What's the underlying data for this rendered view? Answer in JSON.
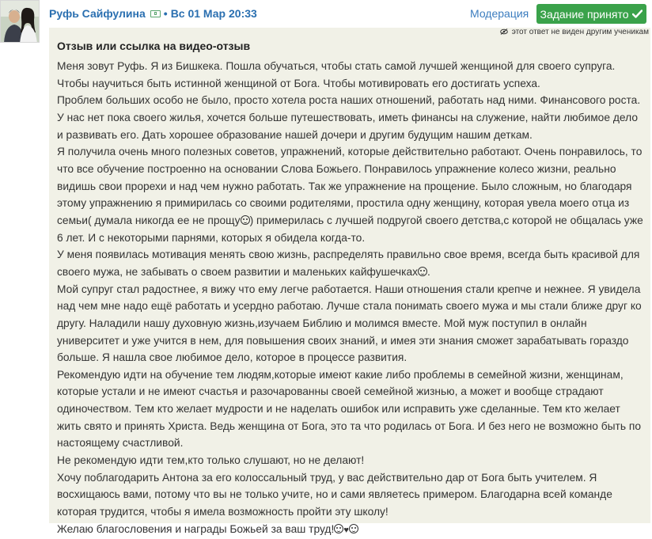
{
  "author": {
    "name": "Руфь Сайфулина",
    "separator": "•",
    "datetime": "Вс 01 Мар 20:33"
  },
  "actions": {
    "moderation_label": "Модерация",
    "status_label": "Задание принято"
  },
  "post": {
    "visibility_note": "этот ответ не виден другим ученикам",
    "title": "Отзыв или ссылка на видео-отзыв",
    "paragraphs": [
      "Меня зовут Руфь. Я из Бишкека. Пошла обучаться, чтобы стать самой лучшей женщиной для своего супруга. Чтобы научиться быть истинной женщиной от Бога. Чтобы мотивировать его достигать успеха.",
      "Проблем больших особо не было, просто хотела роста наших отношений, работать над ними. Финансового роста. У нас нет пока своего жилья, хочется больше путешествовать, иметь финансы на служение, найти любимое дело и развивать его. Дать хорошее образование нашей дочери и другим будущим нашим деткам.",
      "Я получила очень много полезных советов, упражнений, которые действительно работают. Очень понравилось, то что все обучение построенно на основании Слова Божьего. Понравилось упражнение колесо жизни, реально видишь свои прорехи и над чем нужно работать. Так же упражнение на прощение. Было сложным, но благодаря этому упражнению я примирилась со своими родителями, простила одну женщину, которая увела моего отца из семьи( думала никогда ее не прощу",
      ") примерилась с лучшей подругой своего детства,с которой не общалась уже 6 лет. И с некоторыми парнями, которых я обидела когда-то.",
      "У меня появилась мотивация менять свою жизнь, распределять правильно свое время, всегда быть красивой для своего мужа, не забывать о своем развитии и маленьких кайфушечках",
      ".",
      "Мой супруг стал радостнее, я вижу что ему легче работается. Наши отношения стали крепче и нежнее. Я увидела над чем мне надо ещё работать и усердно работаю. Лучше стала понимать своего мужа и мы стали ближе друг ко другу. Наладили нашу духовную жизнь,изучаем Библию и молимся вместе. Мой муж поступил в онлайн университет и уже учится в нем, для повышения своих знаний, и имея эти знания сможет зарабатывать гораздо больше. Я нашла свое любимое дело, которое в процессе развития.",
      "Рекомендую идти на обучение тем людям,которые имеют какие либо проблемы в семейной жизни, женщинам, которые устали и не имеют счастья и разочарованны своей семейной жизнью, а может и вообще страдают одиночеством. Тем кто желает мудрости и не наделать ошибок или исправить уже сделанные. Тем кто желает жить свято и принять Христа. Ведь женщина от Бога, это та что родилась от Бога. И без него не возможно быть по настоящему счастливой.",
      "Не рекомендую идти тем,кто только слушают, но не делают!",
      "Хочу поблагодарить Антона за его колоссальный труд, у вас действительно дар от Бога быть учителем. Я восхищаюсь вами, потому что вы не только учите, но и сами являетесь примером. Благодарна всей команде которая трудится, чтобы я имела возможность пройти эту школу!",
      "Желаю благословения и награды Божьей за ваш труд!"
    ],
    "heart_glyph": "♥"
  },
  "icons": {
    "verified": "verified-badge-icon",
    "check": "check-icon",
    "eye": "eye-slash-icon"
  },
  "colors": {
    "link": "#2a6fb0",
    "success": "#3aa24a",
    "card_background": "#f1f1e7"
  }
}
